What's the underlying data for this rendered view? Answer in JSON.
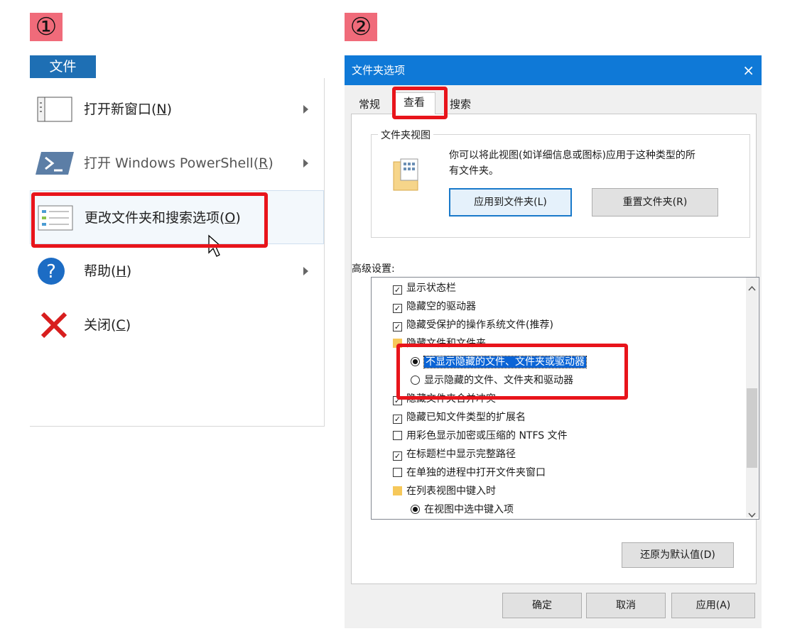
{
  "badges": {
    "panel1": "①",
    "panel2": "②"
  },
  "file_menu": {
    "tab_label": "文件",
    "items": [
      {
        "label": "打开新窗口(",
        "key": "N",
        "end": ")"
      },
      {
        "label": "打开 Windows PowerShell(",
        "key": "R",
        "end": ")"
      },
      {
        "label": "更改文件夹和搜索选项(",
        "key": "O",
        "end": ")"
      },
      {
        "label": "帮助(",
        "key": "H",
        "end": ")"
      },
      {
        "label": "关闭(",
        "key": "C",
        "end": ")"
      }
    ]
  },
  "dialog": {
    "title": "文件夹选项",
    "close": "×",
    "tabs": [
      "常规",
      "查看",
      "搜索"
    ],
    "folder_view": {
      "group_title": "文件夹视图",
      "desc_line1": "你可以将此视图(如详细信息或图标)应用于这种类型的所",
      "desc_line2": "有文件夹。",
      "apply_button": "应用到文件夹(L)",
      "reset_button": "重置文件夹(R)"
    },
    "advanced_label": "高级设置:",
    "tree": [
      {
        "type": "checkbox",
        "checked": true,
        "label": "显示状态栏"
      },
      {
        "type": "checkbox",
        "checked": true,
        "label": "隐藏空的驱动器"
      },
      {
        "type": "checkbox",
        "checked": true,
        "label": "隐藏受保护的操作系统文件(推荐)"
      },
      {
        "type": "folder",
        "label": "隐藏文件和文件夹"
      },
      {
        "type": "radio",
        "checked": true,
        "label": "不显示隐藏的文件、文件夹或驱动器"
      },
      {
        "type": "radio",
        "checked": false,
        "label": "显示隐藏的文件、文件夹和驱动器"
      },
      {
        "type": "checkbox",
        "checked": true,
        "label": "隐藏文件夹合并冲突"
      },
      {
        "type": "checkbox",
        "checked": true,
        "label": "隐藏已知文件类型的扩展名"
      },
      {
        "type": "checkbox",
        "checked": false,
        "label": "用彩色显示加密或压缩的 NTFS 文件"
      },
      {
        "type": "checkbox",
        "checked": true,
        "label": "在标题栏中显示完整路径"
      },
      {
        "type": "checkbox",
        "checked": false,
        "label": "在单独的进程中打开文件夹窗口"
      },
      {
        "type": "folder",
        "label": "在列表视图中键入时"
      },
      {
        "type": "radio",
        "checked": true,
        "label": "在视图中选中键入项"
      }
    ],
    "restore_button": "还原为默认值(D)",
    "ok_button": "确定",
    "cancel_button": "取消",
    "apply_button": "应用(A)"
  },
  "colors": {
    "highlight": "#e8141b",
    "title_bar": "#0f79d7",
    "file_tab": "#1e6fb4",
    "badge": "#f06b7a"
  }
}
